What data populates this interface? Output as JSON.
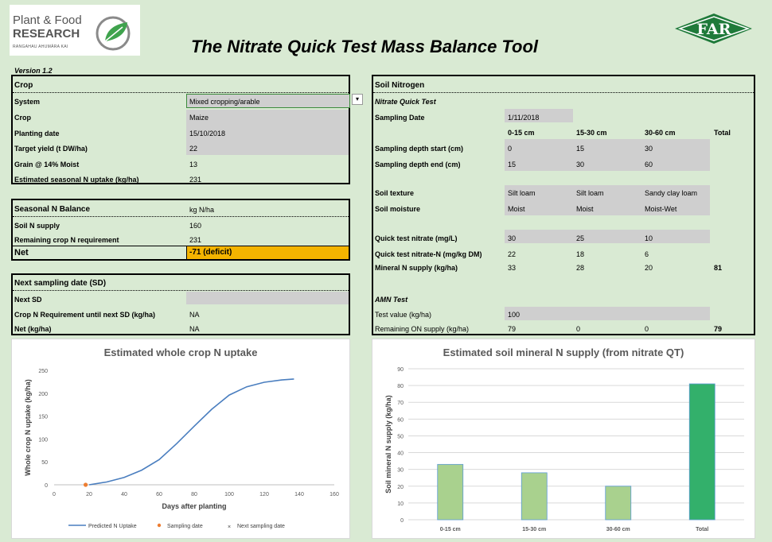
{
  "logo": {
    "line1": "Plant & Food",
    "line2": "RESEARCH",
    "line3": "RANGAHAU AHUMĀRA KAI",
    "right": "FAR"
  },
  "title": "The Nitrate Quick Test Mass Balance Tool",
  "version": "Version 1.2",
  "crop": {
    "header": "Crop",
    "rows": [
      {
        "label": "System",
        "value": "Mixed cropping/arable"
      },
      {
        "label": "Crop",
        "value": "Maize"
      },
      {
        "label": "Planting date",
        "value": "15/10/2018"
      },
      {
        "label": "Target yield (t DW/ha)",
        "value": "22"
      },
      {
        "label": "Grain @ 14% Moist",
        "value": "13"
      },
      {
        "label": "Estimated seasonal N uptake (kg/ha)",
        "value": "231"
      }
    ]
  },
  "balance": {
    "header": "Seasonal N Balance",
    "unit": "kg N/ha",
    "rows": [
      {
        "label": "Soil N supply",
        "value": "160"
      },
      {
        "label": "Remaining crop N requirement",
        "value": "231"
      }
    ],
    "net_label": "Net",
    "net_value": "-71 (deficit)"
  },
  "next_sd": {
    "header": "Next sampling date (SD)",
    "rows": [
      {
        "label": "Next SD",
        "value": ""
      },
      {
        "label": "Crop N Requirement until next SD (kg/ha)",
        "value": "NA"
      },
      {
        "label": "Net (kg/ha)",
        "value": "NA"
      }
    ]
  },
  "soil": {
    "header": "Soil Nitrogen",
    "nqt_header": "Nitrate Quick Test",
    "sampling_date_label": "Sampling Date",
    "sampling_date": "1/11/2018",
    "cols": [
      "0-15 cm",
      "15-30 cm",
      "30-60 cm",
      "Total"
    ],
    "depth_start_label": "Sampling depth start (cm)",
    "depth_start": [
      "0",
      "15",
      "30"
    ],
    "depth_end_label": "Sampling depth end (cm)",
    "depth_end": [
      "15",
      "30",
      "60"
    ],
    "texture_label": "Soil texture",
    "texture": [
      "Silt loam",
      "Silt loam",
      "Sandy clay loam"
    ],
    "moisture_label": "Soil moisture",
    "moisture": [
      "Moist",
      "Moist",
      "Moist-Wet"
    ],
    "qt_label": "Quick test nitrate (mg/L)",
    "qt": [
      "30",
      "25",
      "10"
    ],
    "qtn_label": "Quick test nitrate-N (mg/kg DM)",
    "qtn": [
      "22",
      "18",
      "6"
    ],
    "mineral_label": "Mineral N supply (kg/ha)",
    "mineral": [
      "33",
      "28",
      "20",
      "81"
    ],
    "amn_header": "AMN Test",
    "test_value_label": "Test value (kg/ha)",
    "test_value": "100",
    "remaining_label": "Remaining ON supply (kg/ha)",
    "remaining": [
      "79",
      "0",
      "0",
      "79"
    ]
  },
  "charts": {
    "uptake_title": "Estimated whole crop  N uptake",
    "mineral_title": "Estimated  soil mineral N supply (from nitrate QT)"
  },
  "chart_data": [
    {
      "type": "line",
      "title": "Estimated whole crop  N uptake",
      "xlabel": "Days after planting",
      "ylabel": "Whole crop N uptake (kg/ha)",
      "xlim": [
        0,
        160
      ],
      "ylim": [
        0,
        250
      ],
      "xticks": [
        "0",
        "20",
        "40",
        "60",
        "80",
        "100",
        "120",
        "140",
        "160"
      ],
      "yticks": [
        "0",
        "50",
        "100",
        "150",
        "200",
        "250"
      ],
      "series": [
        {
          "name": "Predicted N Uptake",
          "color": "#4a7ebf",
          "x": [
            20,
            30,
            40,
            50,
            60,
            70,
            80,
            90,
            100,
            110,
            120,
            130,
            137
          ],
          "y": [
            0,
            6,
            16,
            32,
            55,
            90,
            128,
            165,
            196,
            214,
            224,
            229,
            231
          ]
        },
        {
          "name": "Sampling date",
          "color": "#ed7d31",
          "x": [
            18
          ],
          "y": [
            0
          ]
        },
        {
          "name": "Next sampling date",
          "color": "#000000",
          "x": [],
          "y": []
        }
      ],
      "legend": "bottom"
    },
    {
      "type": "bar",
      "title": "Estimated  soil mineral N supply (from nitrate QT)",
      "ylabel": "Soil mineral N supply (kg/ha)",
      "ylim": [
        0,
        90
      ],
      "yticks": [
        "0",
        "10",
        "20",
        "30",
        "40",
        "50",
        "60",
        "70",
        "80",
        "90"
      ],
      "categories": [
        "0-15 cm",
        "15-30 cm",
        "30-60 cm",
        "Total"
      ],
      "values": [
        33,
        28,
        20,
        81
      ],
      "colors": [
        "#a9d18e",
        "#a9d18e",
        "#a9d18e",
        "#33b06b"
      ]
    }
  ]
}
